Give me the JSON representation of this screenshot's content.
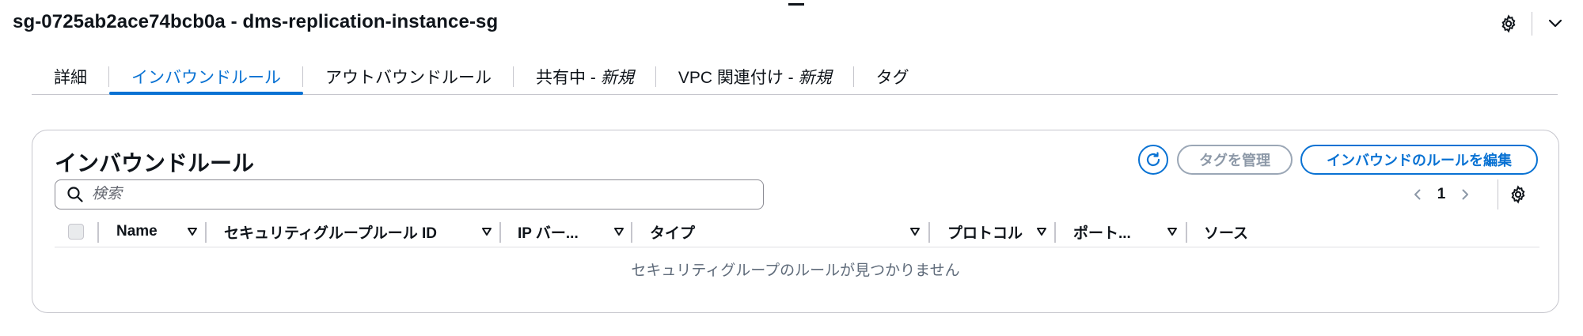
{
  "header": {
    "title": "sg-0725ab2ace74bcb0a - dms-replication-instance-sg"
  },
  "tabs": [
    {
      "label": "詳細",
      "badge": ""
    },
    {
      "label": "インバウンドルール",
      "badge": ""
    },
    {
      "label": "アウトバウンドルール",
      "badge": ""
    },
    {
      "label": "共有中 -",
      "badge": "新規"
    },
    {
      "label": "VPC 関連付け -",
      "badge": "新規"
    },
    {
      "label": "タグ",
      "badge": ""
    }
  ],
  "active_tab": "インバウンドルール",
  "panel": {
    "title": "インバウンドルール",
    "manage_tags_label": "タグを管理",
    "edit_rules_label": "インバウンドのルールを編集",
    "search_placeholder": "検索",
    "search_value": "",
    "page_number": "1",
    "columns": [
      "Name",
      "セキュリティグループルール ID",
      "IP バー...",
      "タイプ",
      "プロトコル",
      "ポート...",
      "ソース"
    ],
    "empty_message": "セキュリティグループのルールが見つかりません"
  },
  "colors": {
    "accent": "#0972d3",
    "text": "#0f141a",
    "muted": "#5f6b7a",
    "border": "#c6c6cd",
    "disabled": "#8d99a8"
  },
  "icons": [
    "settings-icon",
    "chevron-down-icon",
    "refresh-icon",
    "search-icon",
    "chevron-left-icon",
    "chevron-right-icon",
    "sort-icon"
  ]
}
